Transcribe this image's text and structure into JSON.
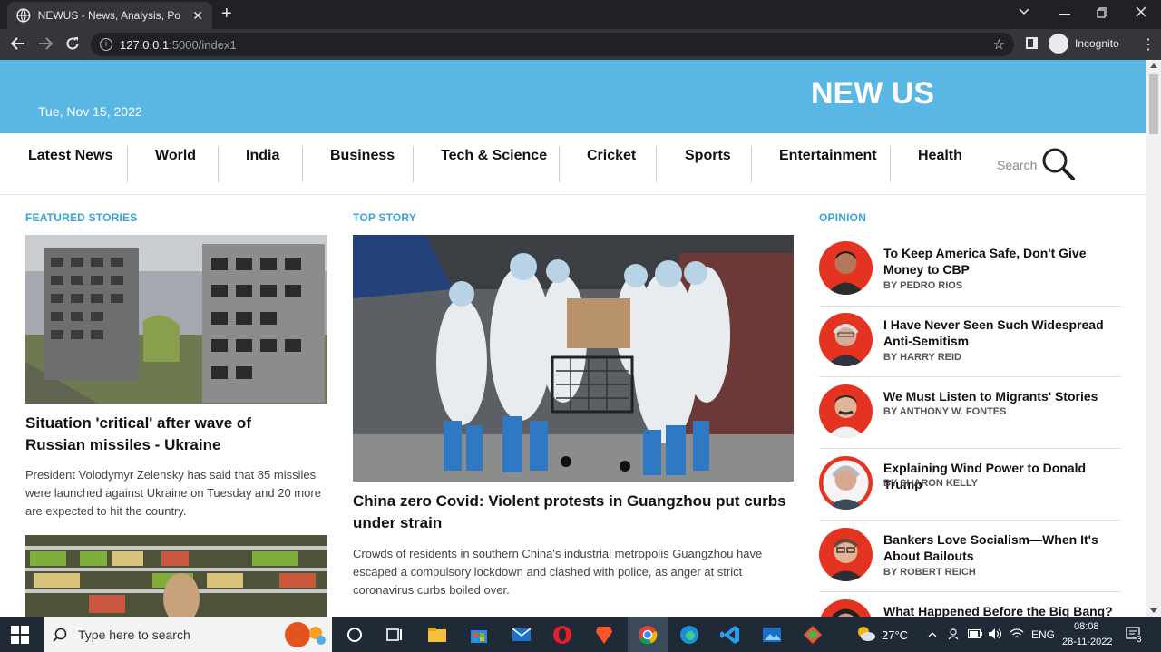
{
  "browser": {
    "tab_title": "NEWUS - News, Analysis, Politics",
    "tab_close": "✕",
    "new_tab": "+",
    "url_host": "127.0.0.1",
    "url_path": ":5000/index1",
    "profile_label": "Incognito"
  },
  "site": {
    "date": "Tue, Nov 15, 2022",
    "logo": "NEW US",
    "accent_color": "#5ab7e4",
    "nav": [
      "Latest News",
      "World",
      "India",
      "Business",
      "Tech & Science",
      "Cricket",
      "Sports",
      "Entertainment",
      "Health"
    ],
    "search_label": "Search"
  },
  "featured": {
    "heading": "FEATURED STORIES",
    "story1": {
      "headline": "Situation 'critical' after wave of Russian missiles - Ukraine",
      "summary": "President Volodymyr Zelensky has said that 85 missiles were launched against Ukraine on Tuesday and 20 more are expected to hit the country."
    }
  },
  "top": {
    "heading": "TOP STORY",
    "headline": "China zero Covid: Violent protests in Guangzhou put curbs under strain",
    "summary": "Crowds of residents in southern China's industrial metropolis Guangzhou have escaped a compulsory lockdown and clashed with police, as anger at strict coronavirus curbs boiled over."
  },
  "opinion": {
    "heading": "OPINION",
    "items": [
      {
        "title": "To Keep America Safe, Don't Give Money to CBP",
        "author": "BY PEDRO RIOS"
      },
      {
        "title": "I Have Never Seen Such Widespread Anti-Semitism",
        "author": "BY HARRY REID"
      },
      {
        "title": "We Must Listen to Migrants' Stories",
        "author": "BY ANTHONY W. FONTES"
      },
      {
        "title": "Explaining Wind Power to Donald Trump",
        "author": "BY SHARON KELLY"
      },
      {
        "title": "Bankers Love Socialism—When It's About Bailouts",
        "author": "BY ROBERT REICH"
      },
      {
        "title": "What Happened Before the Big Bang?",
        "author": ""
      }
    ]
  },
  "taskbar": {
    "search_placeholder": "Type here to search",
    "temperature": "27°C",
    "language": "ENG",
    "time": "08:08",
    "date": "28-11-2022",
    "notifications": "3"
  }
}
